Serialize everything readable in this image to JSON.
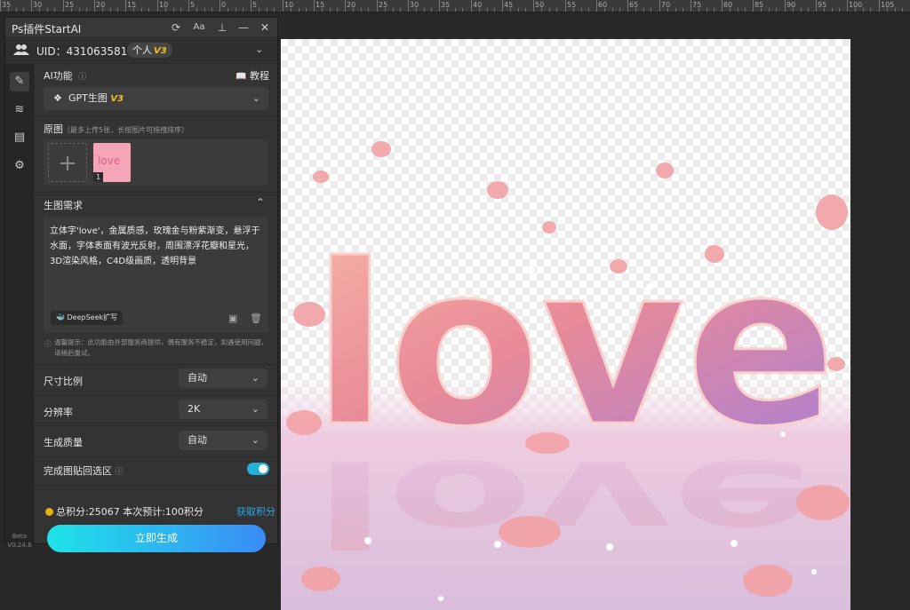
{
  "ruler": {
    "labels": [
      "35",
      "30",
      "25",
      "20",
      "15",
      "10",
      "5",
      "0",
      "5",
      "10",
      "15",
      "20",
      "25",
      "30",
      "35",
      "40",
      "45",
      "50",
      "55",
      "60",
      "65",
      "70",
      "75",
      "80",
      "85",
      "90",
      "95",
      "100",
      "105"
    ]
  },
  "panel": {
    "title": "Ps插件StartAI",
    "uid_text": "UID：4310635814",
    "badge_text": "个人",
    "badge_version": "V3",
    "version_line1": "Beta",
    "version_line2": "V0.24.8"
  },
  "ai_function": {
    "label": "AI功能",
    "tutorial": "教程",
    "selected": "GPT生图",
    "selected_version": "V3"
  },
  "source_image": {
    "label": "原图",
    "hint": "（最多上传5张，长按图片可拖拽排序）",
    "thumb_text": "love",
    "thumb_index": "1"
  },
  "prompt": {
    "label": "生图需求",
    "text": "立体字'love'，金属质感，玫瑰金与粉紫渐变，悬浮于水面，字体表面有波光反射，周围漂浮花瓣和星光，3D渲染风格，C4D级画质，透明背景",
    "deepseek": "DeepSeek扩写",
    "notice": "温馨提示：此功能由外部服务商提供，偶有服务不稳定，如遇使用问题，请稍后重试。"
  },
  "settings": [
    {
      "label": "尺寸比例",
      "value": "自动"
    },
    {
      "label": "分辨率",
      "value": "2K"
    },
    {
      "label": "生成质量",
      "value": "自动"
    }
  ],
  "paste_back": {
    "label": "完成图贴回选区",
    "enabled": true
  },
  "points": {
    "text": "总积分:25067  本次预计:100积分",
    "get": "获取积分"
  },
  "generate_button": "立即生成",
  "canvas": {
    "word": "love"
  },
  "colors": {
    "accent": "#23b0d8",
    "button_start": "#1ee3e8",
    "button_end": "#3b8cf6",
    "coin": "#e3b20c",
    "version": "#f0c020"
  }
}
